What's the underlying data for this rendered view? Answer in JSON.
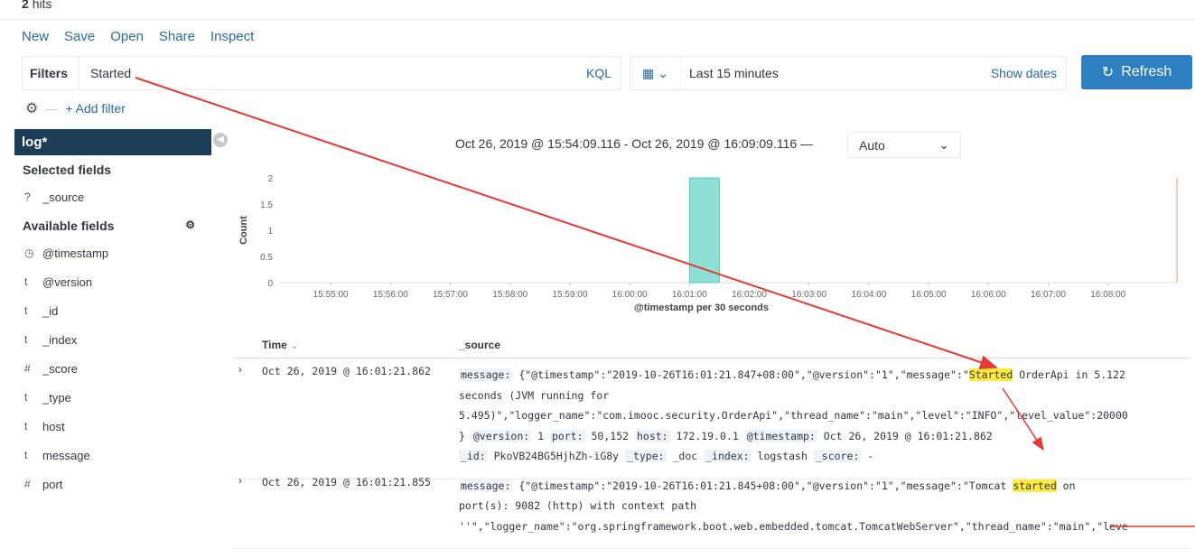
{
  "hits": {
    "count": "2",
    "label": "hits"
  },
  "menu": [
    "New",
    "Save",
    "Open",
    "Share",
    "Inspect"
  ],
  "filters": {
    "label": "Filters",
    "query": "Started",
    "language": "KQL",
    "add_filter": "+ Add filter"
  },
  "datepicker": {
    "range": "Last 15 minutes",
    "show_dates": "Show dates"
  },
  "refresh": {
    "label": "Refresh",
    "color": "#2d7fc2"
  },
  "sidebar": {
    "index_pattern": "log*",
    "selected_title": "Selected fields",
    "selected": [
      {
        "type": "?",
        "name": "_source"
      }
    ],
    "available_title": "Available fields",
    "available": [
      {
        "type": "clock",
        "name": "@timestamp"
      },
      {
        "type": "t",
        "name": "@version"
      },
      {
        "type": "t",
        "name": "_id"
      },
      {
        "type": "t",
        "name": "_index"
      },
      {
        "type": "#",
        "name": "_score"
      },
      {
        "type": "t",
        "name": "_type"
      },
      {
        "type": "t",
        "name": "host"
      },
      {
        "type": "t",
        "name": "message"
      },
      {
        "type": "#",
        "name": "port"
      }
    ]
  },
  "histogram": {
    "time_range": "Oct 26, 2019 @ 15:54:09.116 - Oct 26, 2019 @ 16:09:09.116 —",
    "interval": "Auto",
    "xlabel": "@timestamp per 30 seconds",
    "ylabel": "Count"
  },
  "chart_data": {
    "type": "bar",
    "xlabel": "@timestamp per 30 seconds",
    "ylabel": "Count",
    "ylim": [
      0,
      2
    ],
    "yticks": [
      "0",
      "0.5",
      "1",
      "1.5",
      "2"
    ],
    "xticks": [
      "15:55:00",
      "15:56:00",
      "15:57:00",
      "15:58:00",
      "15:59:00",
      "16:00:00",
      "16:01:00",
      "16:02:00",
      "16:03:00",
      "16:04:00",
      "16:05:00",
      "16:06:00",
      "16:07:00",
      "16:08:00"
    ],
    "bars": [
      {
        "x": "16:01:00",
        "value": 2
      }
    ],
    "bar_color": "#8ee0d6"
  },
  "table": {
    "headers": [
      "Time",
      "_source"
    ],
    "rows": [
      {
        "time": "Oct 26, 2019 @ 16:01:21.862",
        "lines": [
          [
            {
              "k": "message:"
            },
            {
              "v": " {\"@timestamp\":\"2019-10-26T16:01:21.847+08:00\",\"@version\":\"1\",\"message\":\""
            },
            {
              "h": "Started"
            },
            {
              "v": " OrderApi in 5.122"
            }
          ],
          [
            {
              "v": "seconds (JVM running for"
            }
          ],
          [
            {
              "v": "5.495)\",\"logger_name\":\"com.imooc.security.OrderApi\",\"thread_name\":\"main\",\"level\":\"INFO\",\"level_value\":20000"
            }
          ],
          [
            {
              "v": "} "
            },
            {
              "k": "@version:"
            },
            {
              "v": " 1 "
            },
            {
              "k": "port:"
            },
            {
              "v": " 50,152 "
            },
            {
              "k": "host:"
            },
            {
              "v": " 172.19.0.1 "
            },
            {
              "k": "@timestamp:"
            },
            {
              "v": " Oct 26, 2019 @ 16:01:21.862"
            }
          ],
          [
            {
              "k": "_id:"
            },
            {
              "v": " PkoVB24BG5HjhZh-iG8y "
            },
            {
              "k": "_type:"
            },
            {
              "v": " _doc "
            },
            {
              "k": "_index:"
            },
            {
              "v": " logstash "
            },
            {
              "k": "_score:"
            },
            {
              "v": " -"
            }
          ]
        ]
      },
      {
        "time": "Oct 26, 2019 @ 16:01:21.855",
        "lines": [
          [
            {
              "k": "message:"
            },
            {
              "v": " {\"@timestamp\":\"2019-10-26T16:01:21.845+08:00\",\"@version\":\"1\",\"message\":\"Tomcat "
            },
            {
              "h": "started"
            },
            {
              "v": " on"
            }
          ],
          [
            {
              "v": "port(s): 9082 (http) with context path"
            }
          ],
          [
            {
              "v": "''\",\"logger_name\":\"org.springframework.boot.web.embedded.tomcat.TomcatWebServer\",\"thread_name\":\"main\",\"leve"
            }
          ]
        ]
      }
    ]
  }
}
